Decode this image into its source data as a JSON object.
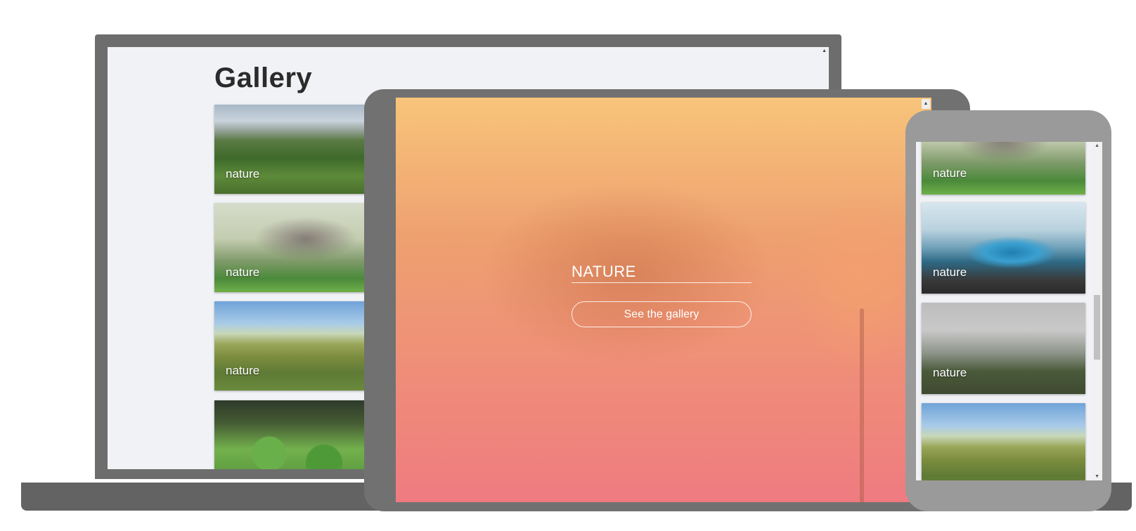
{
  "laptop": {
    "title": "Gallery",
    "cards": [
      {
        "caption": "nature",
        "image": "hills-landscape"
      },
      {
        "caption": "nature",
        "image": "bare-tree"
      },
      {
        "caption": "nature",
        "image": "hay-field"
      },
      {
        "caption": "",
        "image": "clover-leaves"
      }
    ]
  },
  "tablet": {
    "hero_title": "NATURE",
    "button_label": "See the gallery"
  },
  "phone": {
    "cards": [
      {
        "caption": "nature",
        "image": "bare-tree"
      },
      {
        "caption": "nature",
        "image": "ocean-wave"
      },
      {
        "caption": "nature",
        "image": "foggy-valley"
      },
      {
        "caption": "",
        "image": "hay-field"
      }
    ]
  },
  "colors": {
    "device_frame": "#6d6d6d",
    "screen_bg": "#f1f2f6",
    "gradient_top": "#f8c47a",
    "gradient_bottom": "#ef7b80"
  }
}
